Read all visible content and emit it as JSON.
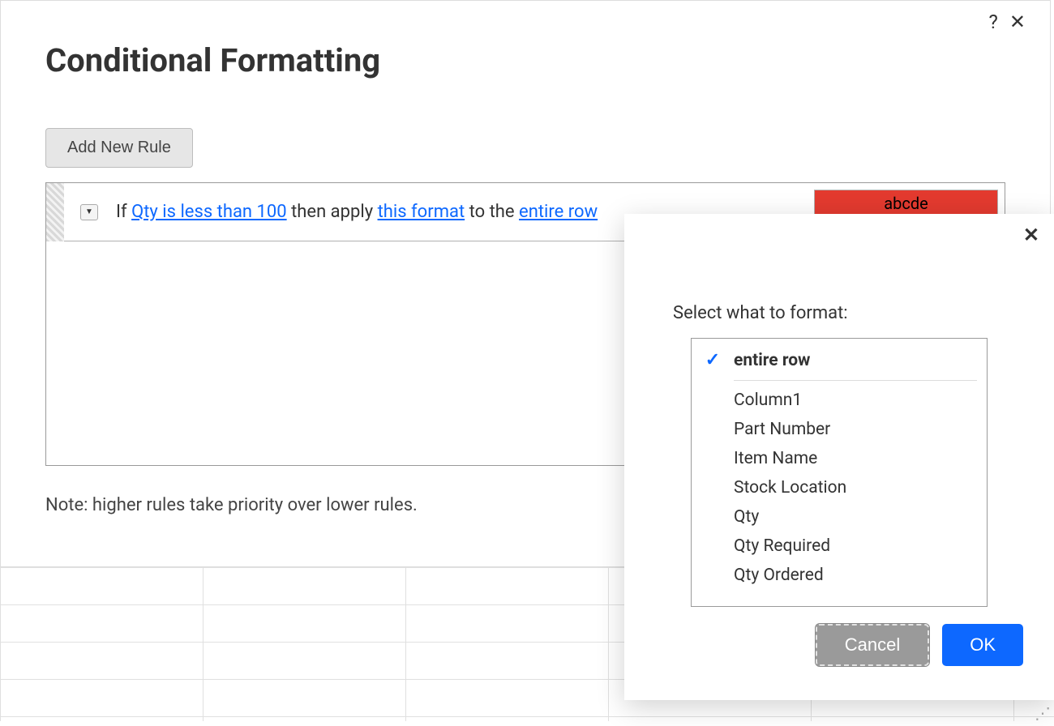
{
  "dialog": {
    "title": "Conditional Formatting",
    "add_rule_label": "Add New Rule",
    "note": "Note: higher rules take priority over lower rules.",
    "rule": {
      "prefix": "If ",
      "condition": "Qty is less than 100",
      "mid1": " then apply ",
      "format_link": "this format",
      "mid2": " to the ",
      "scope_link": "entire row",
      "preview_text": "abcde",
      "preview_bg": "#e33a2f"
    }
  },
  "popup": {
    "heading": "Select what to format:",
    "selected": "entire row",
    "options": [
      "entire row",
      "Column1",
      "Part Number",
      "Item Name",
      "Stock Location",
      "Qty",
      "Qty Required",
      "Qty Ordered"
    ],
    "cancel_label": "Cancel",
    "ok_label": "OK"
  }
}
